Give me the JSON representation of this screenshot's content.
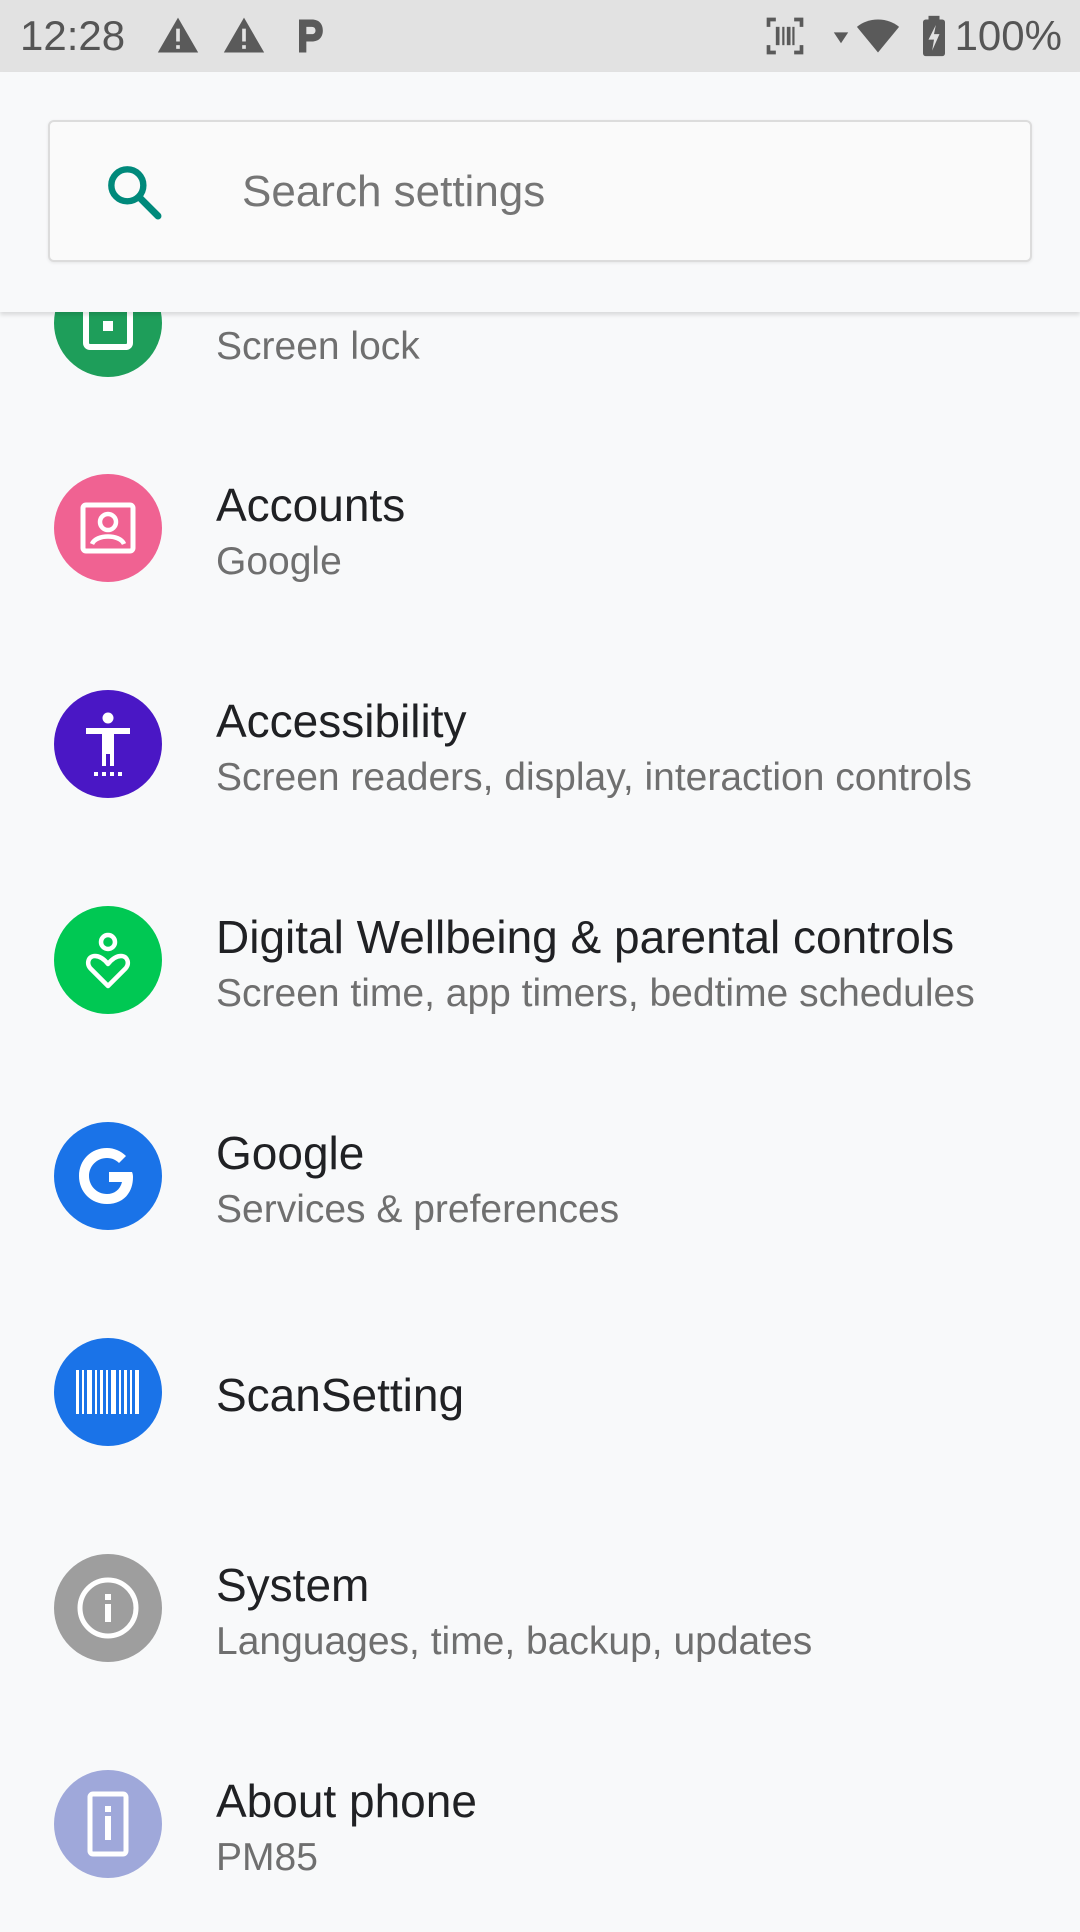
{
  "status_bar": {
    "time": "12:28",
    "battery": "100%",
    "icons": [
      "warning-icon",
      "warning-icon",
      "parking-icon",
      "barcode-scanner-icon",
      "wifi-icon",
      "battery-charging-icon"
    ]
  },
  "search": {
    "placeholder": "Search settings",
    "accent": "#00897b"
  },
  "settings": [
    {
      "title": "",
      "subtitle": "Screen lock",
      "icon": "security-lock-icon",
      "color": "#1e9e5a"
    },
    {
      "title": "Accounts",
      "subtitle": "Google",
      "icon": "accounts-icon",
      "color": "#f06292"
    },
    {
      "title": "Accessibility",
      "subtitle": "Screen readers, display, interaction controls",
      "icon": "accessibility-icon",
      "color": "#4a17c5"
    },
    {
      "title": "Digital Wellbeing & parental controls",
      "subtitle": "Screen time, app timers, bedtime schedules",
      "icon": "wellbeing-icon",
      "color": "#00c853"
    },
    {
      "title": "Google",
      "subtitle": "Services & preferences",
      "icon": "google-icon",
      "color": "#1a73e8"
    },
    {
      "title": "ScanSetting",
      "subtitle": "",
      "icon": "barcode-icon",
      "color": "#1a73e8"
    },
    {
      "title": "System",
      "subtitle": "Languages, time, backup, updates",
      "icon": "info-icon",
      "color": "#9e9e9e"
    },
    {
      "title": "About phone",
      "subtitle": "PM85",
      "icon": "phone-icon",
      "color": "#9fa8da"
    }
  ]
}
